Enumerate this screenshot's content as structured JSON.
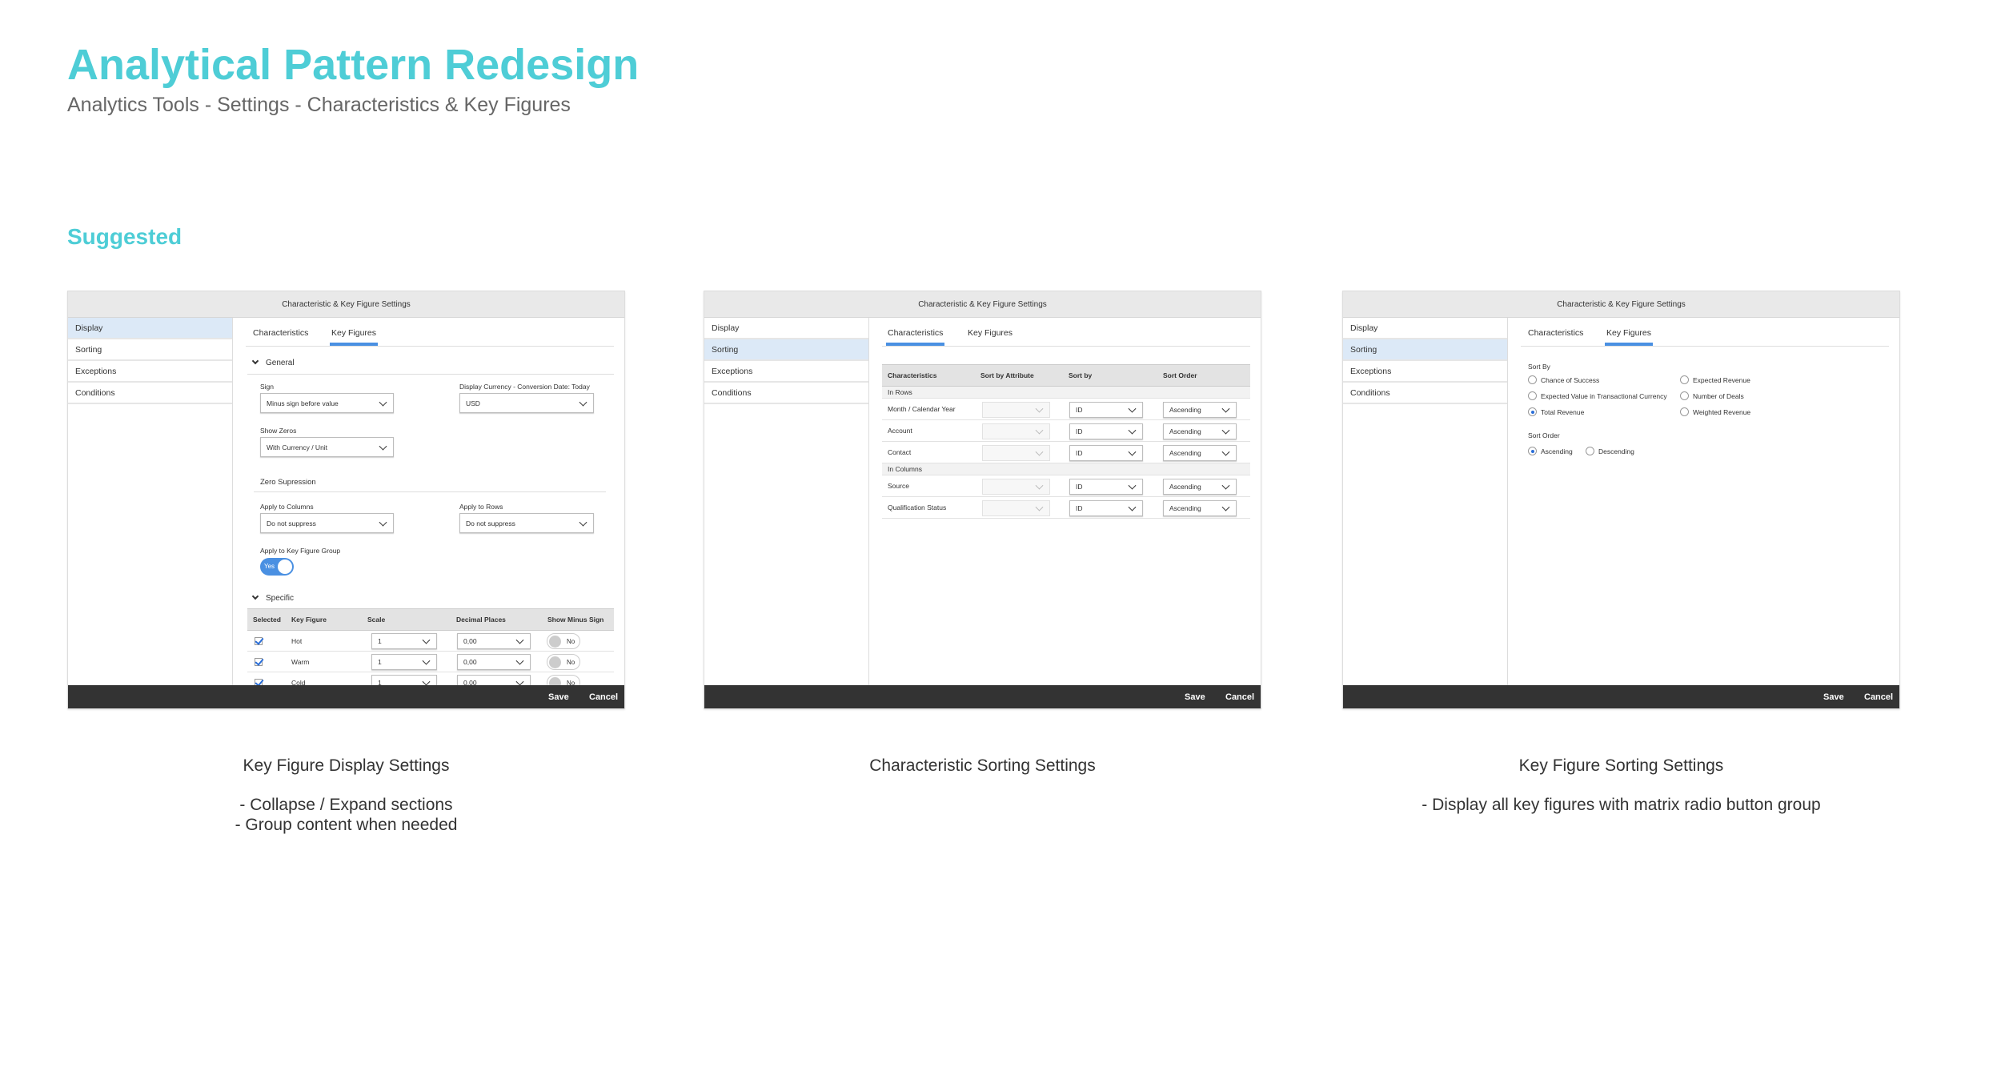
{
  "page": {
    "title": "Analytical Pattern Redesign",
    "subtitle": "Analytics Tools - Settings - Characteristics & Key Figures",
    "section": "Suggested"
  },
  "colors": {
    "accent_teal": "#4ecdd6",
    "accent_blue": "#4a90e2",
    "selected_nav": "#dce9f7",
    "footer": "#333333"
  },
  "dialog": {
    "title": "Characteristic & Key Figure Settings",
    "nav": [
      "Display",
      "Sorting",
      "Exceptions",
      "Conditions"
    ],
    "tabs": [
      "Characteristics",
      "Key Figures"
    ],
    "save": "Save",
    "cancel": "Cancel"
  },
  "panel1": {
    "active_nav": "Display",
    "active_tab": "Key Figures",
    "general": {
      "heading": "General",
      "sign_label": "Sign",
      "sign_value": "Minus sign before value",
      "currency_label": "Display Currency - Conversion Date: Today",
      "currency_value": "USD",
      "zeros_label": "Show Zeros",
      "zeros_value": "With Currency / Unit"
    },
    "zero_suppression": {
      "heading": "Zero Supression",
      "columns_label": "Apply to Columns",
      "columns_value": "Do not suppress",
      "rows_label": "Apply to Rows",
      "rows_value": "Do not suppress",
      "group_label": "Apply to Key Figure Group",
      "group_toggle": "Yes"
    },
    "specific": {
      "heading": "Specific",
      "columns": [
        "Selected",
        "Key Figure",
        "Scale",
        "Decimal Places",
        "Show Minus Sign"
      ],
      "rows": [
        {
          "key_figure": "Hot",
          "selected": true,
          "scale": "1",
          "decimals": "0,00",
          "minus": "No"
        },
        {
          "key_figure": "Warm",
          "selected": true,
          "scale": "1",
          "decimals": "0,00",
          "minus": "No"
        },
        {
          "key_figure": "Cold",
          "selected": true,
          "scale": "1",
          "decimals": "0,00",
          "minus": "No"
        }
      ]
    },
    "caption": [
      "Key Figure Display Settings",
      "- Collapse / Expand sections",
      "- Group content when needed"
    ]
  },
  "panel2": {
    "active_nav": "Sorting",
    "active_tab": "Characteristics",
    "columns": [
      "Characteristics",
      "Sort by Attribute",
      "Sort by",
      "Sort Order"
    ],
    "groups": [
      "In Rows",
      "In Columns"
    ],
    "rows": [
      {
        "name": "Month / Calendar Year",
        "attribute": "",
        "sort_by": "ID",
        "order": "Ascending"
      },
      {
        "name": "Account",
        "attribute": "",
        "sort_by": "ID",
        "order": "Ascending"
      },
      {
        "name": "Contact",
        "attribute": "",
        "sort_by": "ID",
        "order": "Ascending"
      },
      {
        "name": "Source",
        "attribute": "",
        "sort_by": "ID",
        "order": "Ascending"
      },
      {
        "name": "Qualification Status",
        "attribute": "",
        "sort_by": "ID",
        "order": "Ascending"
      }
    ],
    "caption": [
      "Characteristic Sorting Settings"
    ]
  },
  "panel3": {
    "active_nav": "Sorting",
    "active_tab": "Key Figures",
    "sort_by_label": "Sort By",
    "sort_by_options": [
      "Chance of Success",
      "Expected Revenue",
      "Expected Value in Transactional Currency",
      "Number of Deals",
      "Total Revenue",
      "Weighted Revenue"
    ],
    "sort_by_selected": "Total Revenue",
    "sort_order_label": "Sort Order",
    "sort_order_options": [
      "Ascending",
      "Descending"
    ],
    "sort_order_selected": "Ascending",
    "caption": [
      "Key Figure Sorting Settings",
      "- Display all key figures with matrix radio button group"
    ]
  }
}
